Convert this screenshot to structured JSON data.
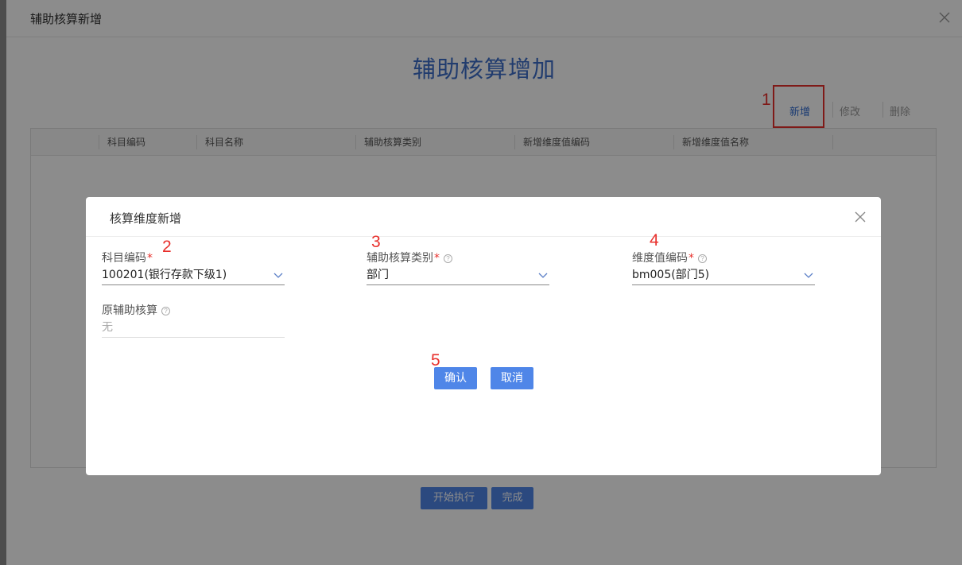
{
  "outer": {
    "title": "辅助核算新增",
    "page_title": "辅助核算增加",
    "toolbar": {
      "marker": "1",
      "add_label": "新增",
      "edit_label": "修改",
      "delete_label": "删除"
    },
    "table": {
      "columns": [
        "科目编码",
        "科目名称",
        "辅助核算类别",
        "新增维度值编码",
        "新增维度值名称"
      ]
    },
    "start_label": "开始执行",
    "done_label": "完成"
  },
  "modal": {
    "title": "核算维度新增",
    "fields": {
      "account_code": {
        "label": "科目编码",
        "required": "*",
        "value": "100201(银行存款下级1)",
        "marker": "2"
      },
      "aux_category": {
        "label": "辅助核算类别",
        "required": "*",
        "help": "?",
        "value": "部门",
        "marker": "3"
      },
      "dim_code": {
        "label": "维度值编码",
        "required": "*",
        "help": "?",
        "value": "bm005(部门5)",
        "marker": "4"
      },
      "original_aux": {
        "label": "原辅助核算",
        "help": "?",
        "value": "无"
      }
    },
    "marker5": "5",
    "confirm_label": "确认",
    "cancel_label": "取消"
  },
  "colors": {
    "accent": "#4f86e8",
    "title_blue": "#3d6ec9",
    "annotation_red": "#e8302c"
  }
}
